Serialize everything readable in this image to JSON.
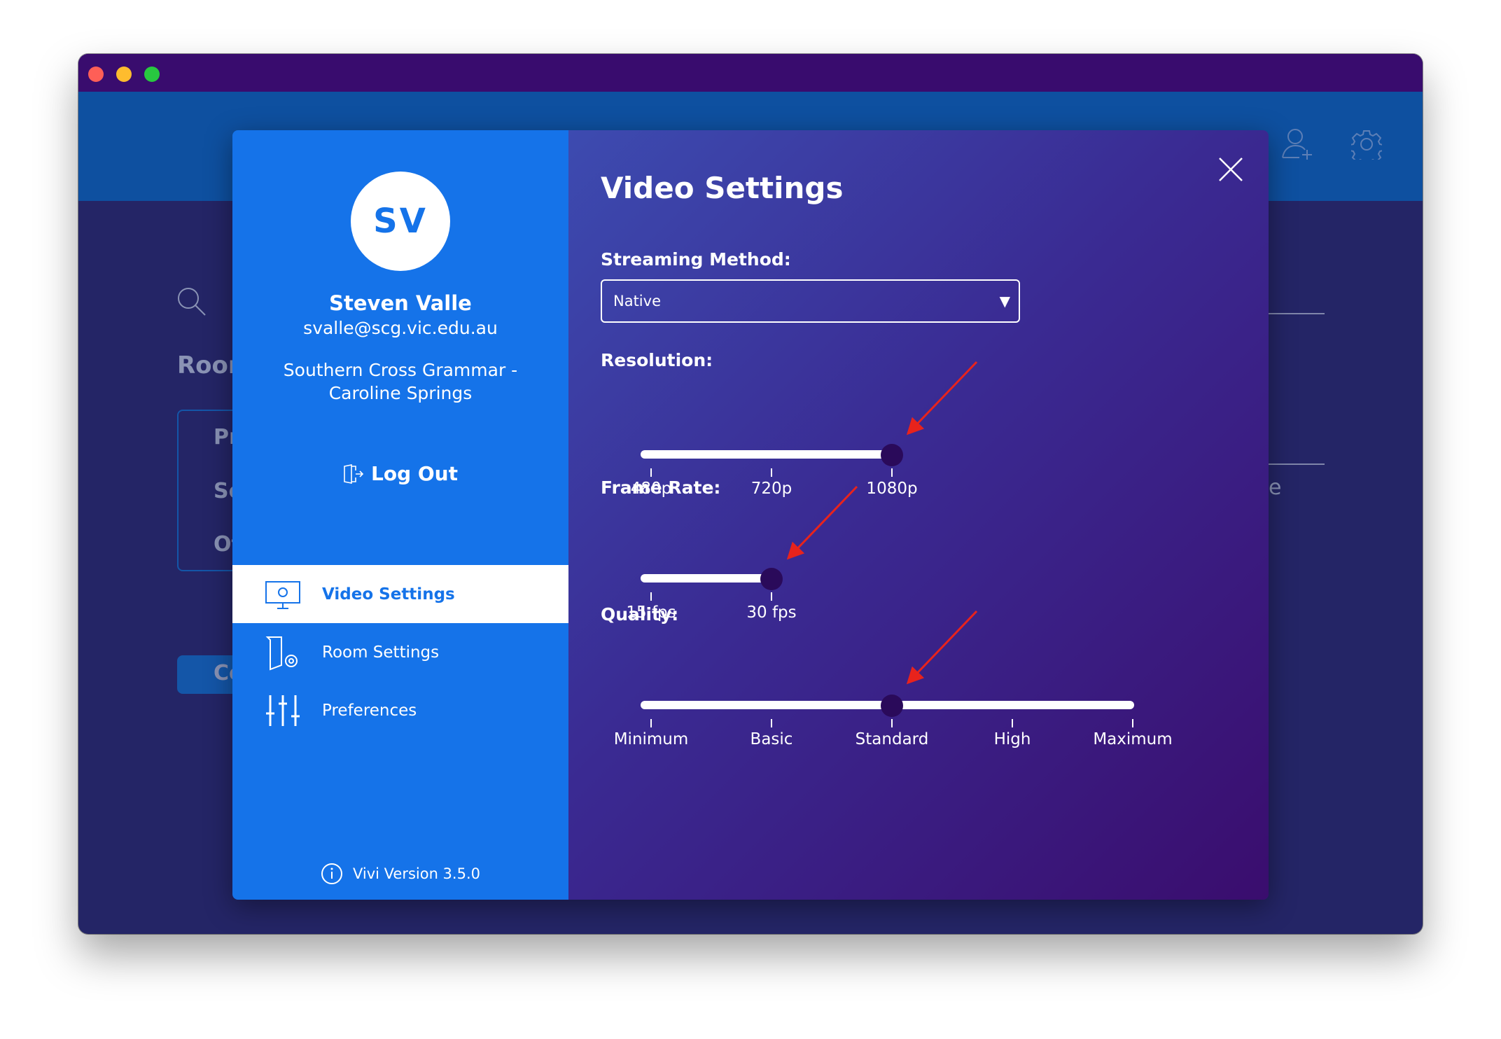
{
  "window": {
    "traffic_lights": [
      "#fe5f57",
      "#febc2e",
      "#28c840"
    ]
  },
  "background": {
    "heading": "Roon",
    "list_items": [
      "Pr",
      "Se",
      "Ot"
    ],
    "button_label": "Co",
    "right_fragment": "e"
  },
  "profile": {
    "initials": "SV",
    "name": "Steven Valle",
    "email": "svalle@scg.vic.edu.au",
    "org_line1": "Southern Cross Grammar -",
    "org_line2": "Caroline Springs",
    "logout_label": "Log Out"
  },
  "nav": {
    "items": [
      {
        "label": "Video Settings",
        "icon": "monitor-gear-icon",
        "active": true
      },
      {
        "label": "Room Settings",
        "icon": "door-gear-icon",
        "active": false
      },
      {
        "label": "Preferences",
        "icon": "sliders-icon",
        "active": false
      }
    ]
  },
  "version": "Vivi Version 3.5.0",
  "settings": {
    "title": "Video Settings",
    "streaming": {
      "label": "Streaming Method:",
      "value": "Native"
    },
    "resolution": {
      "label": "Resolution:",
      "options": [
        "480p",
        "720p",
        "1080p"
      ],
      "selected_index": 2
    },
    "frame_rate": {
      "label": "Frame Rate:",
      "options": [
        "15 fps",
        "30 fps"
      ],
      "selected_index": 1
    },
    "quality": {
      "label": "Quality:",
      "options": [
        "Minimum",
        "Basic",
        "Standard",
        "High",
        "Maximum"
      ],
      "selected_index": 2
    }
  },
  "colors": {
    "accent": "#1573e9",
    "annotation": "#e8231c"
  }
}
